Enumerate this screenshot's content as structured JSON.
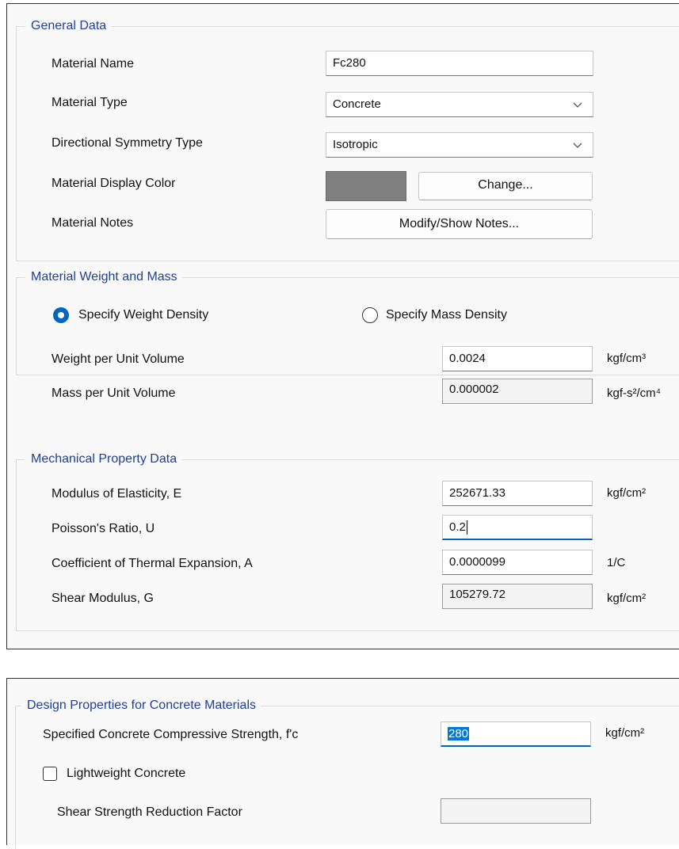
{
  "general": {
    "title": "General Data",
    "material_name_label": "Material Name",
    "material_name_value": "Fc280",
    "material_type_label": "Material Type",
    "material_type_value": "Concrete",
    "symmetry_label": "Directional Symmetry Type",
    "symmetry_value": "Isotropic",
    "display_color_label": "Material Display Color",
    "display_color": "#808080",
    "change_button": "Change...",
    "notes_label": "Material Notes",
    "notes_button": "Modify/Show Notes..."
  },
  "weight_mass": {
    "title": "Material Weight and Mass",
    "radio_weight": "Specify Weight Density",
    "radio_mass": "Specify Mass Density",
    "selected": "weight",
    "weight_label": "Weight per Unit Volume",
    "weight_value": "0.0024",
    "weight_unit": "kgf/cm³",
    "mass_label": "Mass per Unit Volume",
    "mass_value": "0.000002",
    "mass_unit": "kgf-s²/cm⁴"
  },
  "mechanical": {
    "title": "Mechanical Property Data",
    "e_label": "Modulus of Elasticity,  E",
    "e_value": "252671.33",
    "e_unit": "kgf/cm²",
    "u_label": "Poisson's Ratio,  U",
    "u_value": "0.2",
    "a_label": "Coefficient of Thermal Expansion,  A",
    "a_value": "0.0000099",
    "a_unit": "1/C",
    "g_label": "Shear Modulus,  G",
    "g_value": "105279.72",
    "g_unit": "kgf/cm²"
  },
  "design": {
    "title": "Design Properties for Concrete Materials",
    "fc_label": "Specified Concrete Compressive Strength, f'c",
    "fc_value": "280",
    "fc_unit": "kgf/cm²",
    "lightweight_label": "Lightweight Concrete",
    "lightweight_checked": false,
    "shear_reduction_label": "Shear Strength Reduction Factor",
    "shear_reduction_value": ""
  },
  "colors": {
    "group_title": "#1f3f9a",
    "accent": "#0067c0"
  }
}
